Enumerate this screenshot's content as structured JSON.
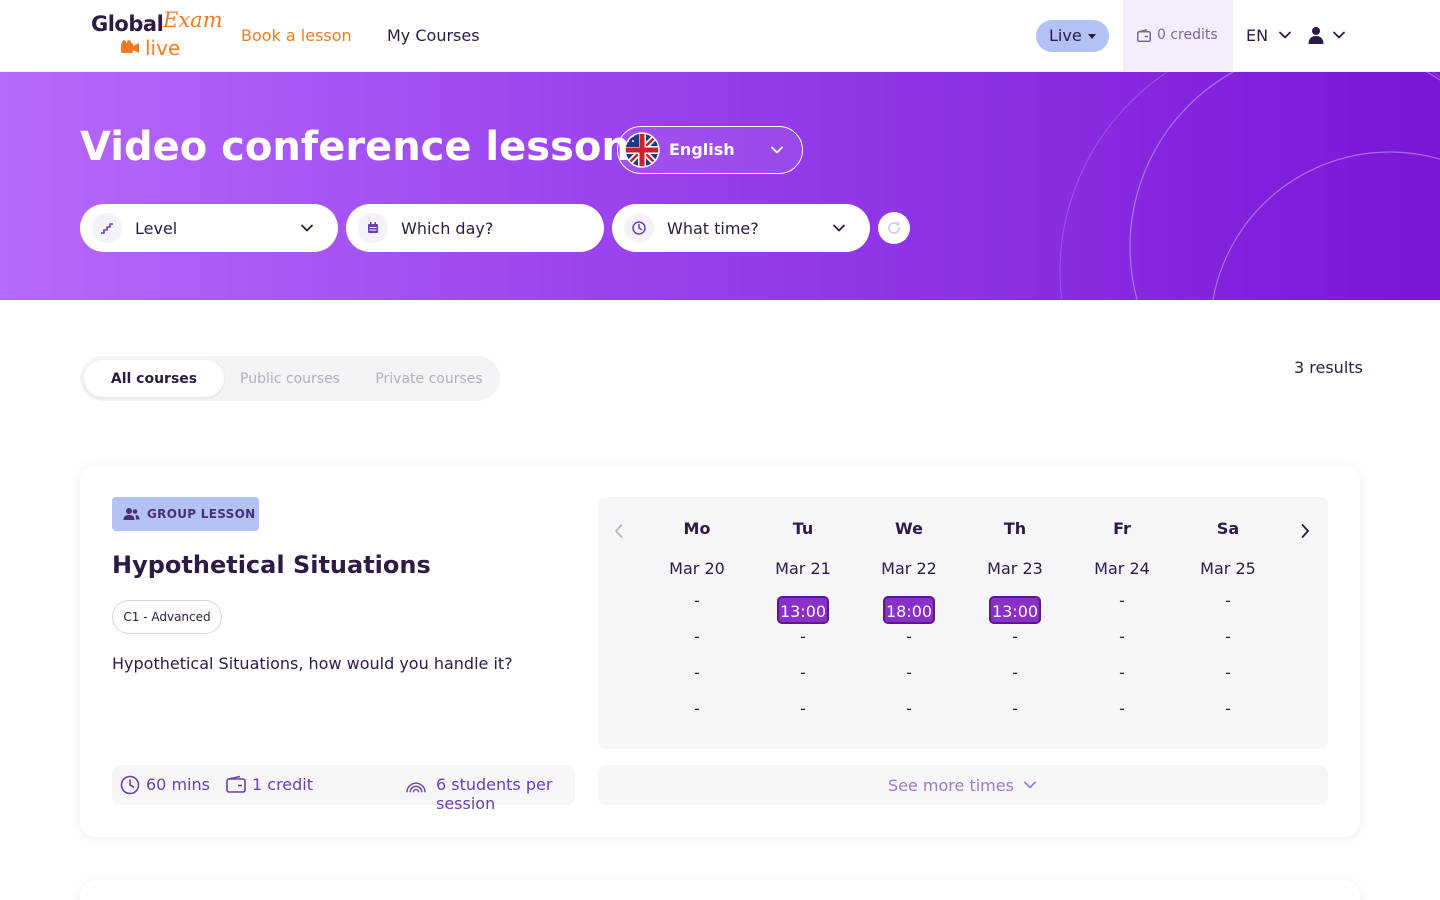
{
  "header": {
    "logo": {
      "global": "Global",
      "exam": "Exam",
      "live": "live"
    },
    "nav": {
      "book": "Book a lesson",
      "courses": "My Courses"
    },
    "live_pill": "Live",
    "credits": "0 credits",
    "language": "EN"
  },
  "hero": {
    "title": "Video conference lesson",
    "language_select": "English",
    "filters": {
      "level": "Level",
      "day": "Which day?",
      "time": "What time?"
    }
  },
  "tabs": {
    "all": "All courses",
    "public": "Public courses",
    "private": "Private courses"
  },
  "results": "3 results",
  "course": {
    "badge": "GROUP LESSON",
    "title": "Hypothetical Situations",
    "level": "C1 - Advanced",
    "description": "Hypothetical Situations, how would you handle it?",
    "duration": "60 mins",
    "credit": "1 credit",
    "students": "6 students per session",
    "see_more": "See more times",
    "schedule": [
      {
        "day": "Mo",
        "date": "Mar 20",
        "slots": [
          "-",
          "-",
          "-",
          "-"
        ]
      },
      {
        "day": "Tu",
        "date": "Mar 21",
        "slots": [
          "13:00",
          "-",
          "-",
          "-"
        ]
      },
      {
        "day": "We",
        "date": "Mar 22",
        "slots": [
          "18:00",
          "-",
          "-",
          "-"
        ]
      },
      {
        "day": "Th",
        "date": "Mar 23",
        "slots": [
          "13:00",
          "-",
          "-",
          "-"
        ]
      },
      {
        "day": "Fr",
        "date": "Mar 24",
        "slots": [
          "-",
          "-",
          "-",
          "-"
        ]
      },
      {
        "day": "Sa",
        "date": "Mar 25",
        "slots": [
          "-",
          "-",
          "-",
          "-"
        ]
      }
    ]
  },
  "colors": {
    "accent": "#f27b21",
    "brand_purple": "#8b2fc9",
    "hero_start": "#b66af9",
    "hero_end": "#7a16d6",
    "badge": "#b4c1f5"
  }
}
